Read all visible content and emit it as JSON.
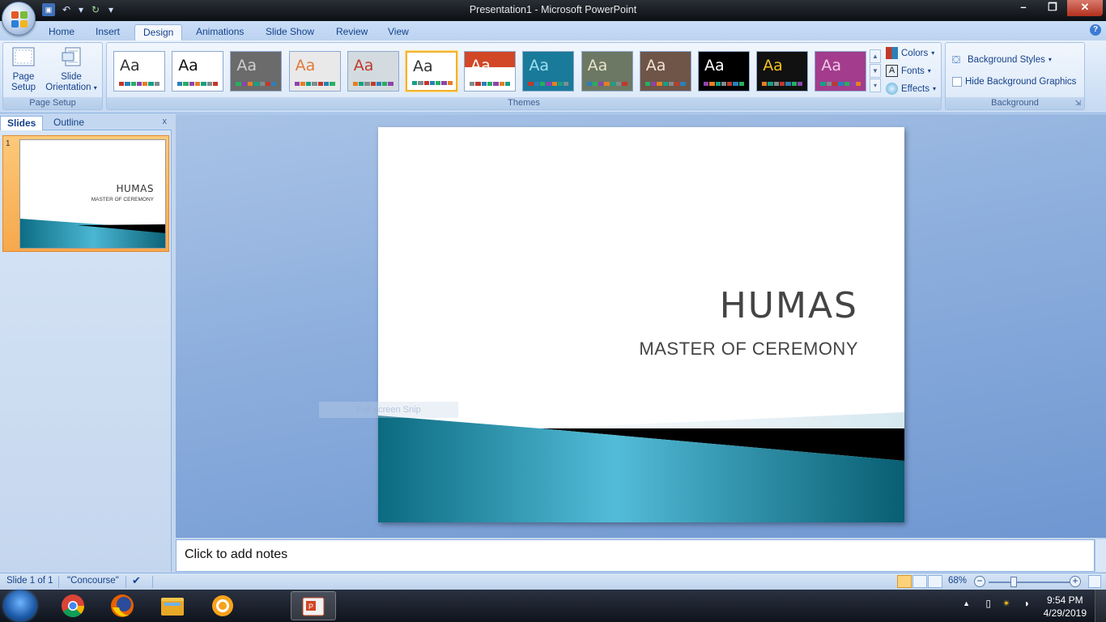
{
  "window": {
    "title": "Presentation1 - Microsoft PowerPoint",
    "minimize": "–",
    "restore": "❐",
    "close": "✕"
  },
  "tabs": [
    {
      "label": "Home"
    },
    {
      "label": "Insert"
    },
    {
      "label": "Design"
    },
    {
      "label": "Animations"
    },
    {
      "label": "Slide Show"
    },
    {
      "label": "Review"
    },
    {
      "label": "View"
    }
  ],
  "active_tab": "Design",
  "ribbon": {
    "page_setup": {
      "page_setup_label_1": "Page",
      "page_setup_label_2": "Setup",
      "slide_orientation_label_1": "Slide",
      "slide_orientation_label_2": "Orientation",
      "group_label": "Page Setup"
    },
    "themes": {
      "group_label": "Themes",
      "items": [
        {
          "aa": "Aa",
          "bg": "#ffffff",
          "fg": "#333333"
        },
        {
          "aa": "Aa",
          "bg": "#ffffff",
          "fg": "#111111"
        },
        {
          "aa": "Aa",
          "bg": "#6b6b6b",
          "fg": "#cfcfcf"
        },
        {
          "aa": "Aa",
          "bg": "#e9e9e9",
          "fg": "#e07a3a"
        },
        {
          "aa": "Aa",
          "bg": "#d3dbe0",
          "fg": "#c0392b"
        },
        {
          "aa": "Aa",
          "bg": "#ffffff",
          "fg": "#333333"
        },
        {
          "aa": "Aa",
          "bg": "#ffffff",
          "fg": "#ffffff"
        },
        {
          "aa": "Aa",
          "bg": "#1a7a9a",
          "fg": "#9fe0f0"
        },
        {
          "aa": "Aa",
          "bg": "#6d7864",
          "fg": "#e7e3c7"
        },
        {
          "aa": "Aa",
          "bg": "#6e5548",
          "fg": "#f2e4d4"
        },
        {
          "aa": "Aa",
          "bg": "#000000",
          "fg": "#ffffff"
        },
        {
          "aa": "Aa",
          "bg": "#111111",
          "fg": "#f5c21b"
        },
        {
          "aa": "Aa",
          "bg": "#a33c8c",
          "fg": "#f0c8e8"
        }
      ],
      "selected_index": 5
    },
    "theme_options": {
      "colors": "Colors",
      "fonts": "Fonts",
      "effects": "Effects"
    },
    "background": {
      "background_styles": "Background Styles",
      "hide_background_graphics": "Hide Background Graphics",
      "hide_background_graphics_checked": false,
      "group_label": "Background"
    }
  },
  "left_pane": {
    "tab_slides": "Slides",
    "tab_outline": "Outline",
    "close": "x",
    "slide_number": "1"
  },
  "slide": {
    "title": "HUMAS",
    "subtitle": "MASTER OF CEREMONY",
    "overlay_text": "Full-screen Snip"
  },
  "notes": {
    "placeholder": "Click to add notes"
  },
  "status": {
    "slide_info": "Slide 1 of 1",
    "theme": "\"Concourse\"",
    "zoom": "68%"
  },
  "taskbar": {
    "time": "9:54 PM",
    "date": "4/29/2019"
  }
}
